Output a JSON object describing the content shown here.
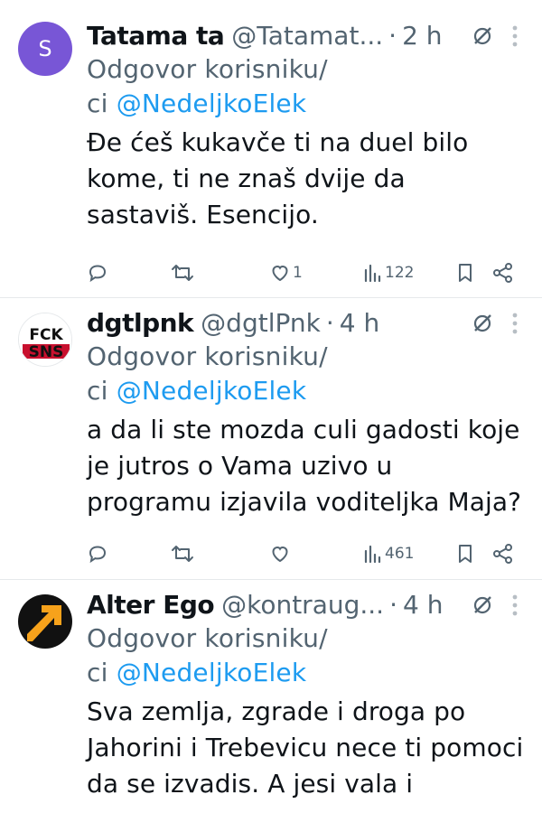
{
  "tweets": [
    {
      "name": "Tatama ta",
      "handle": "@Tatamat...",
      "dot": "·",
      "time": "2 h",
      "avatar_letter": "S",
      "reply_prefix": "Odgovor korisniku/",
      "reply_prefix2": "ci ",
      "reply_mention": "@NedeljkoElek",
      "text": "Đe ćeš kukavče ti na duel bilo kome, ti ne znaš dvije da sastaviš. Esencijo.",
      "likes": "1",
      "views": "122"
    },
    {
      "name": "dgtlpnk",
      "handle": "@dgtlPnk",
      "dot": "·",
      "time": "4 h",
      "avatar_text_top": "FCK",
      "avatar_text_bottom": "SNS",
      "reply_prefix": "Odgovor korisniku/",
      "reply_prefix2": "ci ",
      "reply_mention": "@NedeljkoElek",
      "text": "a da li ste mozda culi gadosti koje je jutros o Vama uzivo u programu izjavila voditeljka Maja?",
      "likes": "",
      "views": "461"
    },
    {
      "name": "Alter Ego",
      "handle": "@kontraug...",
      "dot": "·",
      "time": "4 h",
      "reply_prefix": "Odgovor korisniku/",
      "reply_prefix2": "ci ",
      "reply_mention": "@NedeljkoElek",
      "text": "Sva zemlja, zgrade i droga po Jahorini i Trebevicu nece ti pomoci da se izvadis. A jesi vala i"
    }
  ],
  "colors": {
    "accent": "#1d9bf0",
    "secondary_text": "#536471",
    "avatar_purple": "#7856d6",
    "avatar_orange": "#f7a21b"
  },
  "icons": [
    "reply-icon",
    "retweet-icon",
    "like-icon",
    "views-icon",
    "bookmark-icon",
    "share-icon",
    "grok-icon",
    "more-icon"
  ]
}
